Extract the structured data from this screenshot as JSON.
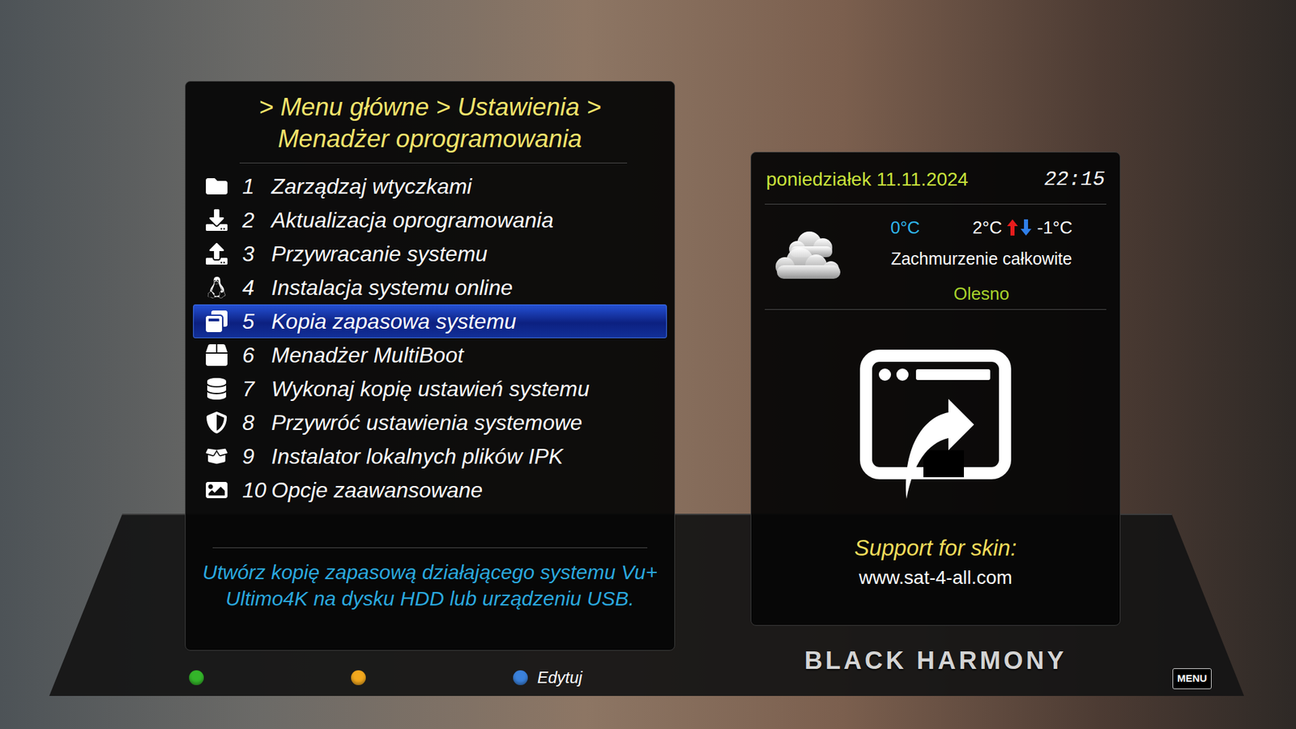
{
  "breadcrumb": {
    "lines": [
      "> Menu główne > Ustawienia >",
      "Menadżer oprogramowania"
    ]
  },
  "menu": [
    {
      "number": "1",
      "label": "Zarządzaj wtyczkami",
      "selected": false
    },
    {
      "number": "2",
      "label": "Aktualizacja oprogramowania",
      "selected": false
    },
    {
      "number": "3",
      "label": "Przywracanie systemu",
      "selected": false
    },
    {
      "number": "4",
      "label": "Instalacja systemu online",
      "selected": false
    },
    {
      "number": "5",
      "label": "Kopia zapasowa systemu",
      "selected": true
    },
    {
      "number": "6",
      "label": "Menadżer MultiBoot",
      "selected": false
    },
    {
      "number": "7",
      "label": "Wykonaj kopię ustawień systemu",
      "selected": false
    },
    {
      "number": "8",
      "label": "Przywróć ustawienia systemowe",
      "selected": false
    },
    {
      "number": "9",
      "label": "Instalator lokalnych plików IPK",
      "selected": false
    },
    {
      "number": "10",
      "label": "Opcje zaawansowane",
      "selected": false
    }
  ],
  "description": "Utwórz kopię zapasową działającego systemu Vu+ Ultimo4K na dysku HDD lub urządzeniu USB.",
  "color_buttons": [
    {
      "color": "#34b52a",
      "label": ""
    },
    {
      "color": "#f2a81e",
      "label": ""
    },
    {
      "color": "#3b82dc",
      "label": "Edytuj"
    }
  ],
  "info_panel": {
    "date": "poniedziałek 11.11.2024",
    "time": "22:15",
    "weather": {
      "current": "0°C",
      "high": "2°C",
      "low": "-1°C",
      "condition": "Zachmurzenie całkowite",
      "city": "Olesno"
    },
    "support_label": "Support for skin:",
    "support_url": "www.sat-4-all.com"
  },
  "skin_logo": "BLACK HARMONY",
  "menu_key": "MENU"
}
